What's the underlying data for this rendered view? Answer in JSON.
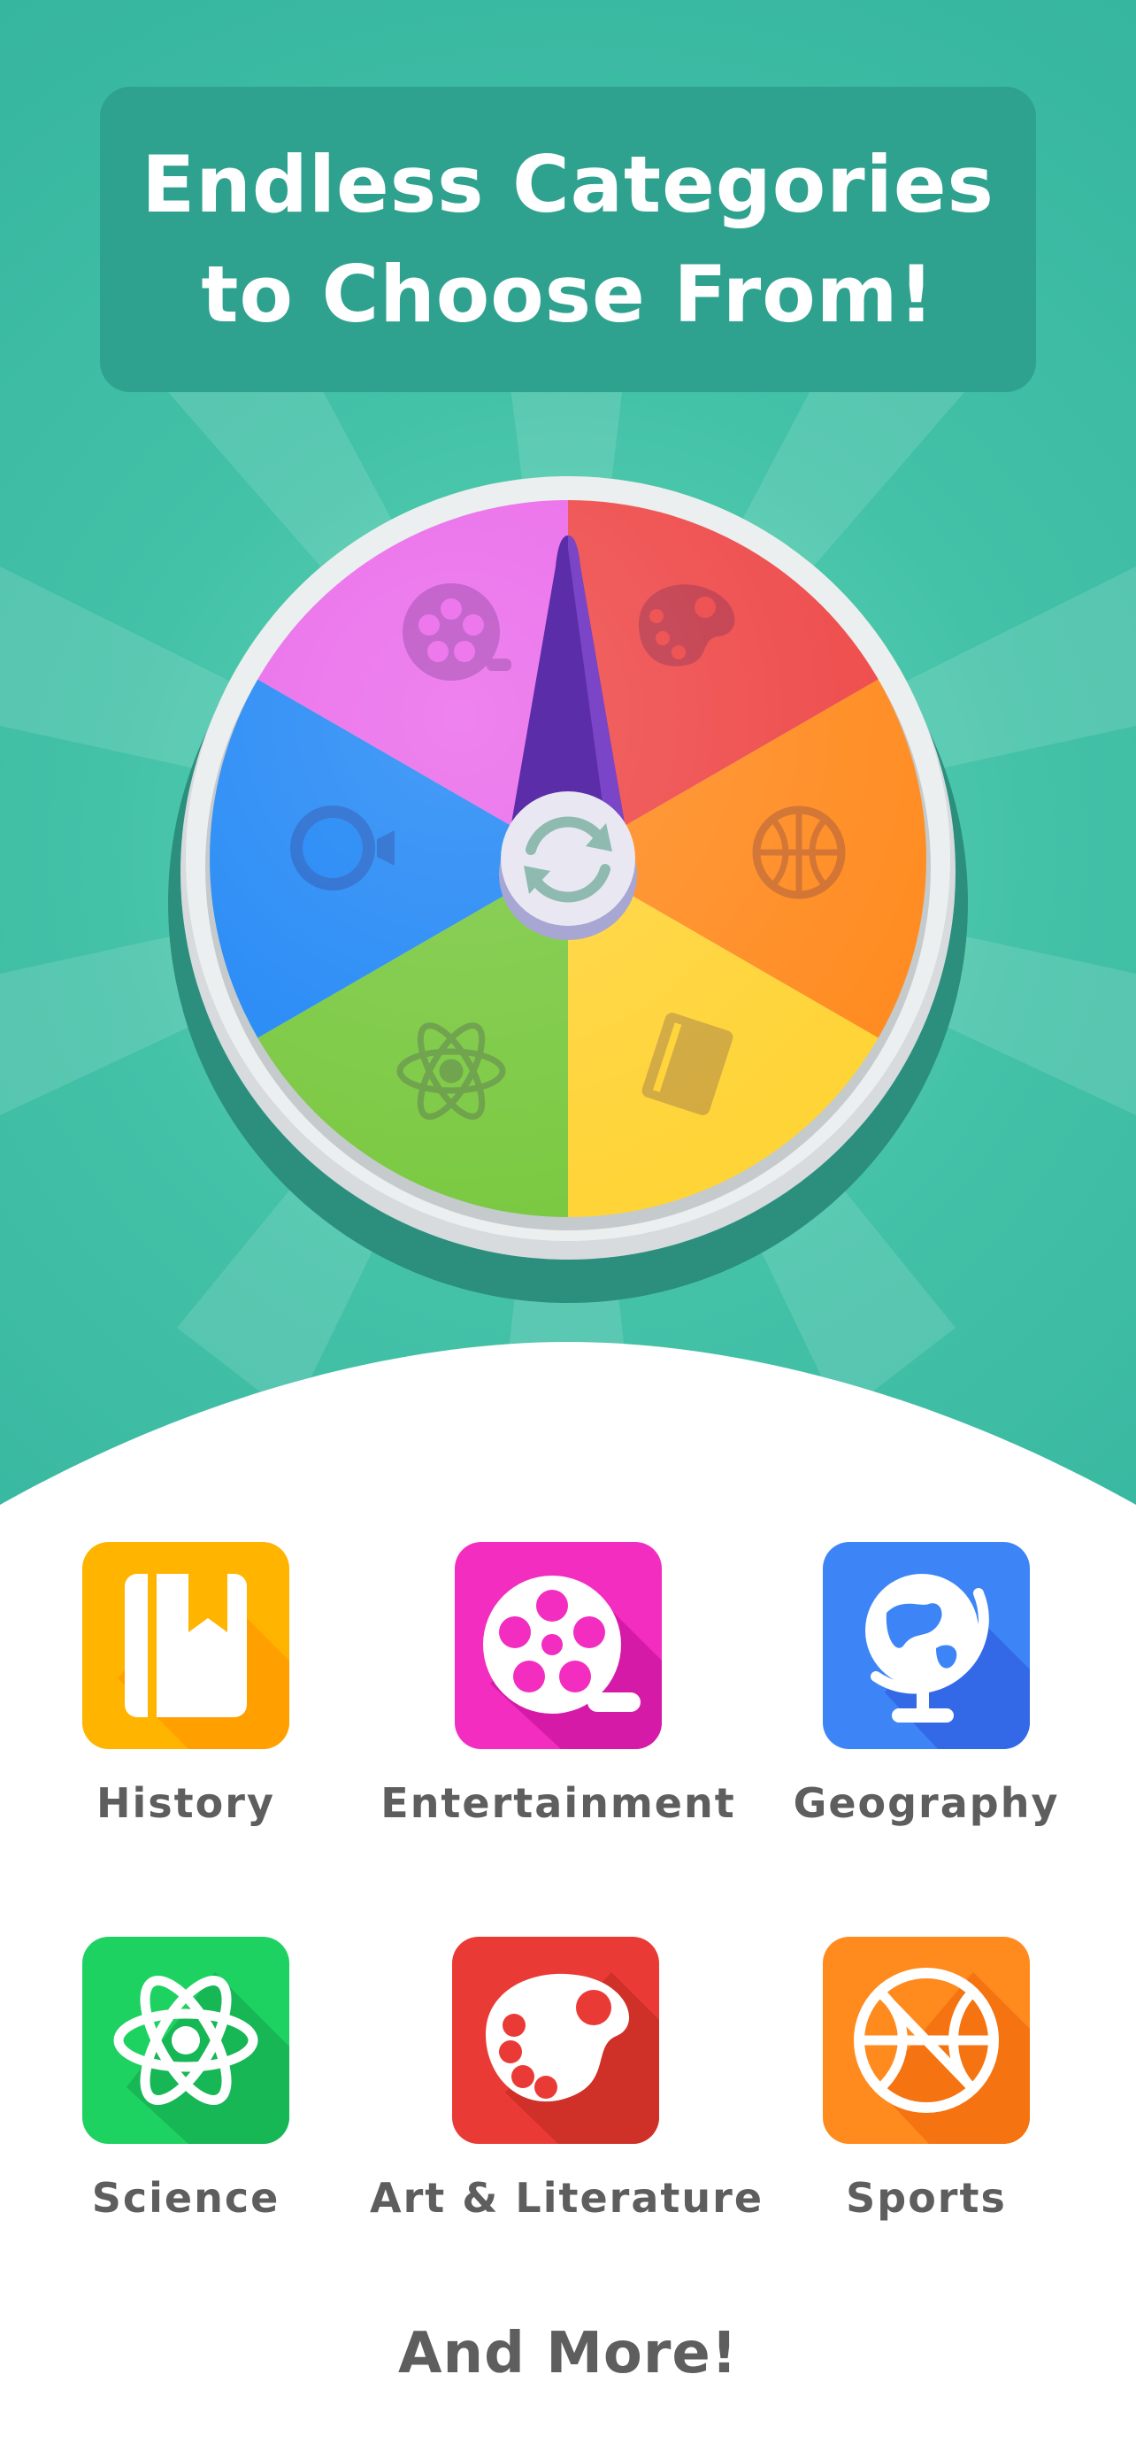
{
  "banner": {
    "line1": "Endless Categories",
    "line2": "to Choose From!"
  },
  "wheel": {
    "segments": [
      {
        "category": "Art & Literature",
        "color": "#ee4646",
        "icon": "palette-icon"
      },
      {
        "category": "Sports",
        "color": "#ff8a1e",
        "icon": "basketball-icon"
      },
      {
        "category": "History",
        "color": "#ffd334",
        "icon": "book-icon"
      },
      {
        "category": "Science",
        "color": "#78c83e",
        "icon": "atom-icon"
      },
      {
        "category": "Geography",
        "color": "#1f86f5",
        "icon": "globe-icon"
      },
      {
        "category": "Entertainment",
        "color": "#ea67ea",
        "icon": "film-reel-icon"
      }
    ],
    "spin_icon": "refresh-icon",
    "pointer_color": "#5b2da8"
  },
  "categories": [
    {
      "label": "History",
      "icon": "book-icon",
      "color": "#ffb400"
    },
    {
      "label": "Entertainment",
      "icon": "film-reel-icon",
      "color": "#f22dc0"
    },
    {
      "label": "Geography",
      "icon": "globe-icon",
      "color": "#3d85f7"
    },
    {
      "label": "Science",
      "icon": "atom-icon",
      "color": "#1ed262"
    },
    {
      "label": "Art & Literature",
      "icon": "palette-icon",
      "color": "#ea3a35"
    },
    {
      "label": "Sports",
      "icon": "basketball-icon",
      "color": "#ff8a1e"
    }
  ],
  "footer": {
    "more_label": "And More!"
  },
  "theme": {
    "teal": "#3bbaa2",
    "banner": "#2ea28f",
    "label_gray": "#5e5e5e"
  }
}
